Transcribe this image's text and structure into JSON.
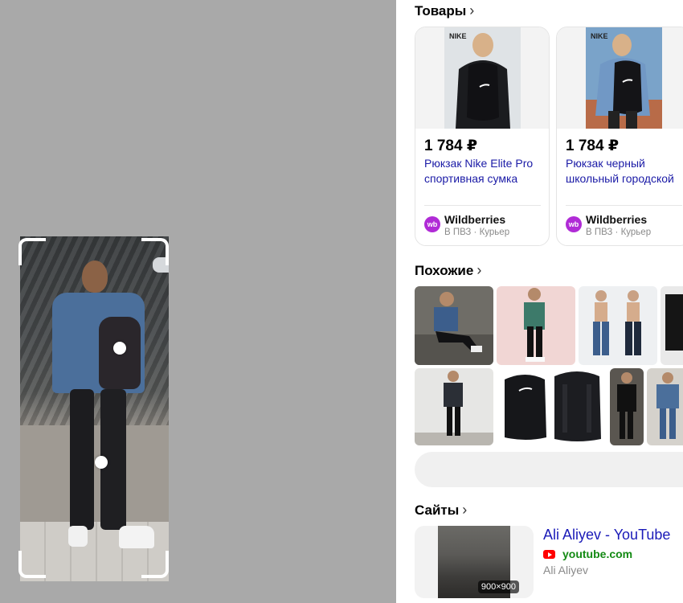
{
  "viewer": {
    "background": "#a9a9a9",
    "hotspot_count": 2
  },
  "products": {
    "section_title": "Товары",
    "items": [
      {
        "price": "1 784 ₽",
        "title": "Рюкзак Nike Elite Pro спортивная сумка",
        "shop": "Wildberries",
        "shop_logo": "wb",
        "delivery": "В ПВЗ · Курьер"
      },
      {
        "price": "1 784 ₽",
        "title": "Рюкзак черный школьный городской",
        "shop": "Wildberries",
        "shop_logo": "wb",
        "delivery": "В ПВЗ · Курьер"
      }
    ]
  },
  "similar": {
    "section_title": "Похожие"
  },
  "sites": {
    "section_title": "Сайты",
    "results": [
      {
        "title": "Ali Aliyev - YouTube",
        "domain": "youtube.com",
        "author": "Ali Aliyev",
        "image_size": "900×900"
      }
    ]
  },
  "colors": {
    "link": "#1a1ab8",
    "domain": "#138a13",
    "wb_brand": "#b02bd6"
  }
}
